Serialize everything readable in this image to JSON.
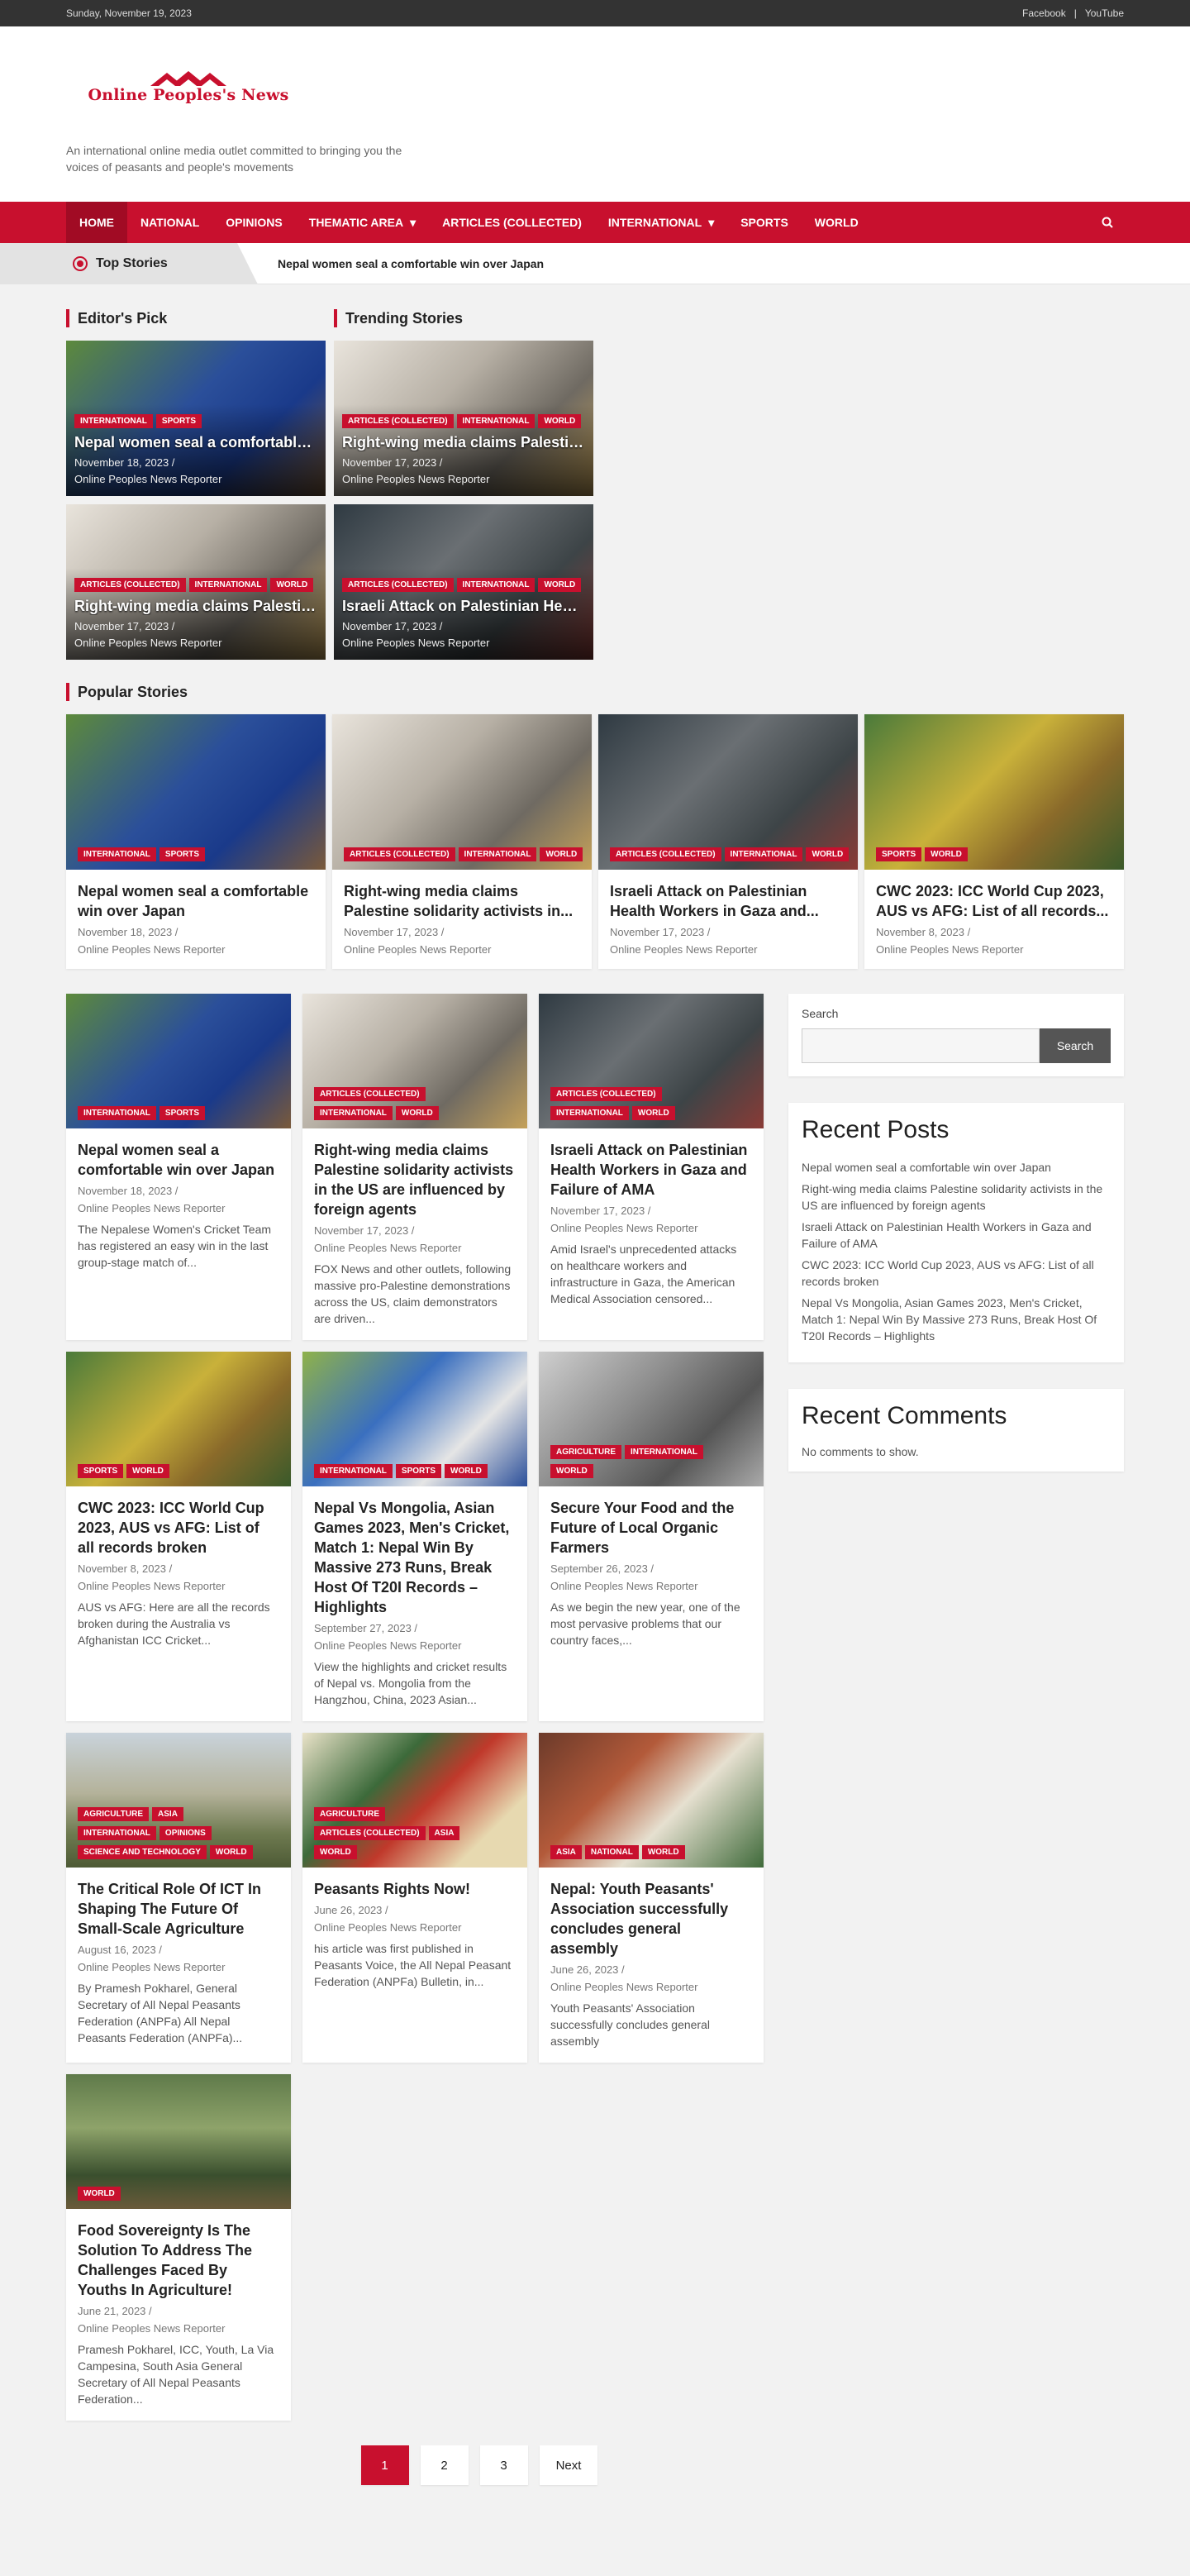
{
  "topbar": {
    "date": "Sunday, November 19, 2023",
    "links": [
      "Facebook",
      "YouTube"
    ],
    "sep": "|"
  },
  "site": {
    "name": "Online Peoples's News",
    "tagline": "An international online media outlet committed to bringing you the voices of peasants and people's movements"
  },
  "nav": {
    "items": [
      "HOME",
      "NATIONAL",
      "OPINIONS",
      "THEMATIC AREA",
      "ARTICLES (COLLECTED)",
      "INTERNATIONAL",
      "SPORTS",
      "WORLD"
    ],
    "dropdown_arrow": "▾"
  },
  "ticker": {
    "label": "Top Stories",
    "text": "Nepal women seal a comfortable win over Japan"
  },
  "editors_pick": {
    "title": "Editor's Pick",
    "items": [
      {
        "badges": [
          "INTERNATIONAL",
          "SPORTS"
        ],
        "title": "Nepal women seal a comfortable win over Japan",
        "date": "November 18, 2023 /",
        "author": "Online Peoples News Reporter"
      },
      {
        "badges": [
          "ARTICLES (COLLECTED)",
          "INTERNATIONAL",
          "WORLD"
        ],
        "title": "Right-wing media claims Palestine solidarity activists in...",
        "date": "November 17, 2023 /",
        "author": "Online Peoples News Reporter"
      }
    ]
  },
  "trending": {
    "title": "Trending Stories",
    "items": [
      {
        "badges": [
          "ARTICLES (COLLECTED)",
          "INTERNATIONAL",
          "WORLD"
        ],
        "title": "Right-wing media claims Palestine solidarity activists in...",
        "date": "November 17, 2023 /",
        "author": "Online Peoples News Reporter"
      },
      {
        "badges": [
          "ARTICLES (COLLECTED)",
          "INTERNATIONAL",
          "WORLD"
        ],
        "title": "Israeli Attack on Palestinian Health Workers in Gaza and...",
        "date": "November 17, 2023 /",
        "author": "Online Peoples News Reporter"
      }
    ]
  },
  "popular": {
    "title": "Popular Stories",
    "items": [
      {
        "badges": [
          "INTERNATIONAL",
          "SPORTS"
        ],
        "title": "Nepal women seal a comfortable win over Japan",
        "date": "November 18, 2023 /",
        "author": "Online Peoples News Reporter"
      },
      {
        "badges": [
          "ARTICLES (COLLECTED)",
          "INTERNATIONAL",
          "WORLD"
        ],
        "title": "Right-wing media claims Palestine solidarity activists in...",
        "date": "November 17, 2023 /",
        "author": "Online Peoples News Reporter"
      },
      {
        "badges": [
          "ARTICLES (COLLECTED)",
          "INTERNATIONAL",
          "WORLD"
        ],
        "title": "Israeli Attack on Palestinian Health Workers in Gaza and...",
        "date": "November 17, 2023 /",
        "author": "Online Peoples News Reporter"
      },
      {
        "badges": [
          "SPORTS",
          "WORLD"
        ],
        "title": "CWC 2023: ICC World Cup 2023, AUS vs AFG: List of all records...",
        "date": "November 8, 2023 /",
        "author": "Online Peoples News Reporter"
      }
    ]
  },
  "posts": [
    {
      "badges": [
        "INTERNATIONAL",
        "SPORTS"
      ],
      "title": "Nepal women seal a comfortable win over Japan",
      "date": "November 18, 2023 /",
      "author": "Online Peoples News Reporter",
      "excerpt": "The Nepalese Women's Cricket Team has registered an easy win in the last group-stage match of..."
    },
    {
      "badges": [
        "ARTICLES (COLLECTED)",
        "INTERNATIONAL",
        "WORLD"
      ],
      "title": "Right-wing media claims Palestine solidarity activists in the US are influenced by foreign agents",
      "date": "November 17, 2023 /",
      "author": "Online Peoples News Reporter",
      "excerpt": "FOX News and other outlets, following massive pro-Palestine demonstrations across the US, claim demonstrators are driven..."
    },
    {
      "badges": [
        "ARTICLES (COLLECTED)",
        "INTERNATIONAL",
        "WORLD"
      ],
      "title": "Israeli Attack on Palestinian Health Workers in Gaza and Failure of AMA",
      "date": "November 17, 2023 /",
      "author": "Online Peoples News Reporter",
      "excerpt": "Amid Israel's unprecedented attacks on healthcare workers and infrastructure in Gaza, the American Medical Association censored..."
    },
    {
      "badges": [
        "SPORTS",
        "WORLD"
      ],
      "title": "CWC 2023: ICC World Cup 2023, AUS vs AFG: List of all records broken",
      "date": "November 8, 2023 /",
      "author": "Online Peoples News Reporter",
      "excerpt": "AUS vs AFG: Here are all the records broken during the Australia vs Afghanistan ICC Cricket..."
    },
    {
      "badges": [
        "INTERNATIONAL",
        "SPORTS",
        "WORLD"
      ],
      "title": "Nepal Vs Mongolia, Asian Games 2023, Men's Cricket, Match 1: Nepal Win By Massive 273 Runs, Break Host Of T20I Records – Highlights",
      "date": "September 27, 2023 /",
      "author": "Online Peoples News Reporter",
      "excerpt": "View the highlights and cricket results of Nepal vs. Mongolia from the Hangzhou, China, 2023 Asian..."
    },
    {
      "badges": [
        "AGRICULTURE",
        "INTERNATIONAL",
        "WORLD"
      ],
      "title": "Secure Your Food and the Future of Local Organic Farmers",
      "date": "September 26, 2023 /",
      "author": "Online Peoples News Reporter",
      "excerpt": "As we begin the new year, one of the most pervasive problems that our country faces,..."
    },
    {
      "badges": [
        "AGRICULTURE",
        "ASIA",
        "INTERNATIONAL",
        "OPINIONS",
        "SCIENCE AND TECHNOLOGY",
        "WORLD"
      ],
      "title": "The Critical Role Of ICT In Shaping The Future Of Small-Scale Agriculture",
      "date": "August 16, 2023 /",
      "author": "Online Peoples News Reporter",
      "excerpt": "By Pramesh Pokharel, General Secretary of All Nepal Peasants Federation (ANPFa) All Nepal Peasants Federation (ANPFa)..."
    },
    {
      "badges": [
        "AGRICULTURE",
        "ARTICLES (COLLECTED)",
        "ASIA",
        "WORLD"
      ],
      "title": "Peasants Rights Now!",
      "date": "June 26, 2023 /",
      "author": "Online Peoples News Reporter",
      "excerpt": "his article was first published in Peasants Voice, the All Nepal Peasant Federation (ANPFa) Bulletin, in..."
    },
    {
      "badges": [
        "ASIA",
        "NATIONAL",
        "WORLD"
      ],
      "title": "Nepal: Youth Peasants' Association successfully concludes general assembly",
      "date": "June 26, 2023 /",
      "author": "Online Peoples News Reporter",
      "excerpt": "Youth Peasants' Association successfully concludes general assembly"
    },
    {
      "badges": [
        "WORLD"
      ],
      "title": "Food Sovereignty Is The Solution To Address The Challenges Faced By Youths In Agriculture!",
      "date": "June 21, 2023 /",
      "author": "Online Peoples News Reporter",
      "excerpt": "Pramesh Pokharel, ICC, Youth, La Via Campesina, South Asia  General Secretary of All Nepal Peasants Federation..."
    }
  ],
  "sidebar": {
    "search_label": "Search",
    "search_button": "Search",
    "recent_posts_title": "Recent Posts",
    "recent_posts": [
      "Nepal women seal a comfortable win over Japan",
      "Right-wing media claims Palestine solidarity activists in the US are influenced by foreign agents",
      "Israeli Attack on Palestinian Health Workers in Gaza and Failure of AMA",
      "CWC 2023: ICC World Cup 2023, AUS vs AFG: List of all records broken",
      "Nepal Vs Mongolia, Asian Games 2023, Men's Cricket, Match 1: Nepal Win By Massive 273 Runs, Break Host Of T20I Records – Highlights"
    ],
    "recent_comments_title": "Recent Comments",
    "recent_comments_text": "No comments to show."
  },
  "pagination": {
    "pages": [
      "1",
      "2",
      "3"
    ],
    "next": "Next"
  },
  "colors": {
    "accent": "#c8102e",
    "topbar": "#333333"
  }
}
